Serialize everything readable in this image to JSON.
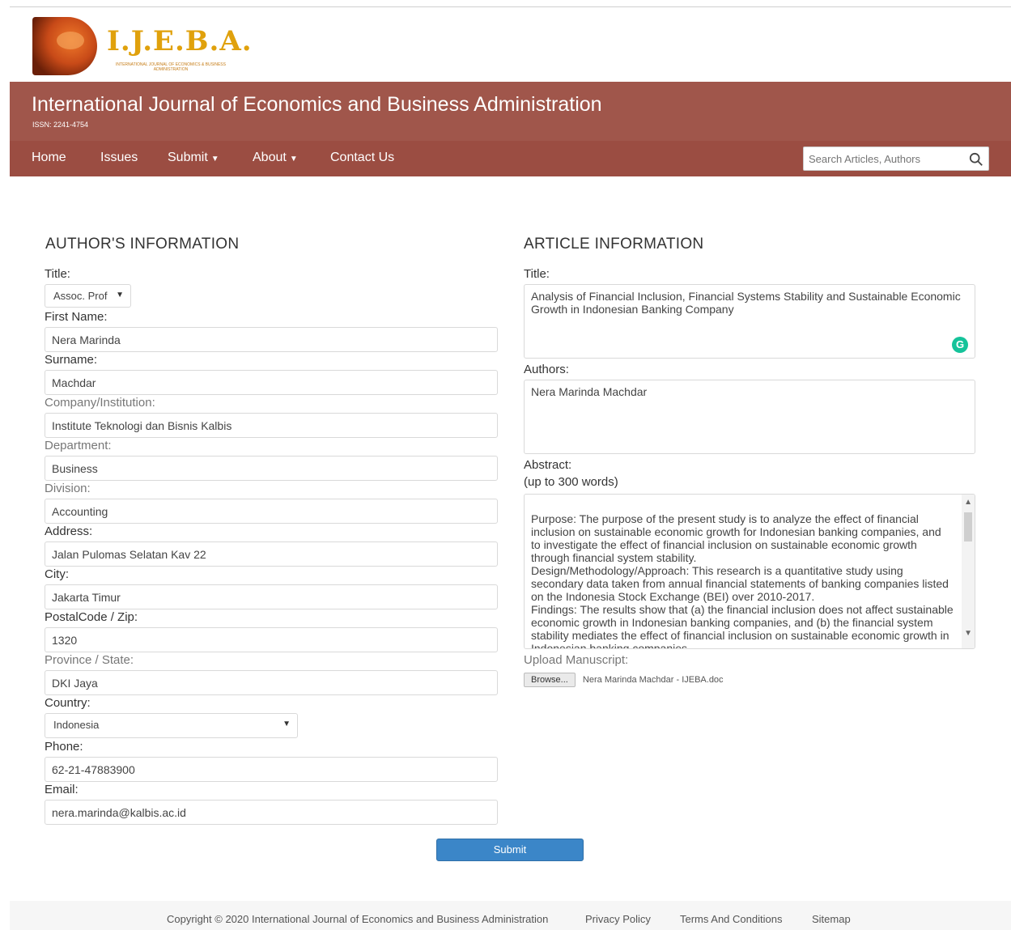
{
  "logo": {
    "name": "I.J.E.B.A.",
    "subtitle": "INTERNATIONAL JOURNAL OF ECONOMICS & BUSINESS ADMINISTRATION"
  },
  "header": {
    "title": "International Journal of Economics and Business Administration",
    "issn": "ISSN: 2241-4754"
  },
  "nav": {
    "home": "Home",
    "issues": "Issues",
    "submit": "Submit",
    "about": "About",
    "contact": "Contact Us",
    "search_placeholder": "Search Articles, Authors"
  },
  "author": {
    "section_title": "AUTHOR'S INFORMATION",
    "title_label": "Title:",
    "title_value": "Assoc. Prof",
    "first_name_label": "First Name:",
    "first_name": "Nera Marinda",
    "surname_label": "Surname:",
    "surname": "Machdar",
    "company_label": "Company/Institution:",
    "company": "Institute Teknologi dan Bisnis Kalbis",
    "department_label": "Department:",
    "department": "Business",
    "division_label": "Division:",
    "division": "Accounting",
    "address_label": "Address:",
    "address": "Jalan Pulomas Selatan Kav 22",
    "city_label": "City:",
    "city": "Jakarta Timur",
    "postal_label": "PostalCode / Zip:",
    "postal": "1320",
    "province_label": "Province / State:",
    "province": "DKI Jaya",
    "country_label": "Country:",
    "country": "Indonesia",
    "phone_label": "Phone:",
    "phone": "62-21-47883900",
    "email_label": "Email:",
    "email": "nera.marinda@kalbis.ac.id"
  },
  "article": {
    "section_title": "ARTICLE INFORMATION",
    "title_label": "Title:",
    "title": "Analysis of Financial Inclusion, Financial Systems Stability and Sustainable Economic Growth in Indonesian Banking Company",
    "authors_label": "Authors:",
    "authors": "Nera Marinda Machdar",
    "abstract_label": "Abstract:",
    "abstract_hint": "(up to 300 words)",
    "abstract": "Purpose: The purpose of the present study is to analyze the effect of financial inclusion on sustainable economic growth for Indonesian banking companies, and to investigate the effect of financial inclusion on sustainable economic growth through financial system stability.\nDesign/Methodology/Approach: This research is a quantitative study using secondary data taken from annual financial statements of banking companies listed on the Indonesia Stock Exchange (BEI) over 2010-2017.\nFindings: The results show that (a) the financial inclusion does not affect sustainable economic growth in Indonesian banking companies, and (b) the financial system stability mediates the effect of financial inclusion on sustainable economic growth in Indonesian banking companies.",
    "upload_label": "Upload Manuscript:",
    "browse_label": "Browse...",
    "file_name": "Nera Marinda Machdar - IJEBA.doc"
  },
  "submit_label": "Submit",
  "footer": {
    "copyright": "Copyright © 2020 International Journal of Economics and Business Administration",
    "privacy": "Privacy Policy",
    "terms": "Terms And Conditions",
    "sitemap": "Sitemap"
  }
}
